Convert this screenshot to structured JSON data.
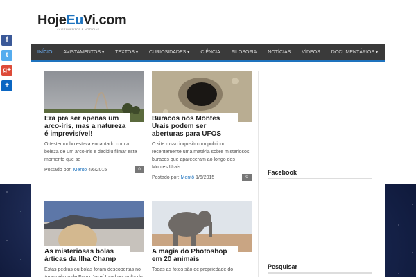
{
  "site": {
    "logo_part1": "Hoje",
    "logo_accent": "Eu",
    "logo_part2": "Vi.com",
    "tagline": "AVISTAMENTOS E NOTÍCIAS"
  },
  "nav": {
    "items": [
      {
        "label": "INÍCIO",
        "has_caret": false
      },
      {
        "label": "AVISTAMENTOS",
        "has_caret": true
      },
      {
        "label": "TEXTOS",
        "has_caret": true
      },
      {
        "label": "CURIOSIDADES",
        "has_caret": true
      },
      {
        "label": "CIÊNCIA",
        "has_caret": false
      },
      {
        "label": "FILOSOFIA",
        "has_caret": false
      },
      {
        "label": "NOTÍCIAS",
        "has_caret": false
      },
      {
        "label": "VÍDEOS",
        "has_caret": false
      },
      {
        "label": "DOCUMENTÁRIOS",
        "has_caret": true
      }
    ]
  },
  "posts": [
    {
      "title": "Era pra ser apenas um arco-íris, mas a natureza é imprevisível!",
      "excerpt": "O testemunho estava encantado com a beleza de um arco-íris e decidiu filmar este momento que se",
      "meta_prefix": "Postado por:",
      "author": "Mentö",
      "date": "4/6/2015",
      "comments": "0"
    },
    {
      "title": "Buracos nos Montes Urais podem ser aberturas para UFOS",
      "excerpt": "O site russo inquisitr.com publicou recentemente uma matéria sobre misteriosos buracos que apareceram ao longo dos Montes Urais",
      "meta_prefix": "Postado por:",
      "author": "Mentö",
      "date": "1/6/2015",
      "comments": "0"
    },
    {
      "title": "As misteriosas bolas árticas da Ilha Champ",
      "excerpt": "Estas pedras ou bolas foram descobertas no Arquipélago de Franz Josef Land por volta do"
    },
    {
      "title": "A magia do Photoshop em 20 animais",
      "excerpt": "Todas as fotos são de propriedade do"
    }
  ],
  "sidebar": {
    "widgets": [
      {
        "title": "Facebook"
      },
      {
        "title": "Pesquisar"
      }
    ]
  },
  "share": [
    {
      "icon": "facebook-icon",
      "glyph": "f",
      "color": "#3b5998"
    },
    {
      "icon": "twitter-icon",
      "glyph": "t",
      "color": "#55acee"
    },
    {
      "icon": "google-plus-icon",
      "glyph": "g+",
      "color": "#dd4b39"
    },
    {
      "icon": "share-icon",
      "glyph": "+",
      "color": "#0a66c2"
    }
  ],
  "colors": {
    "accent": "#1e73be",
    "nav_bg": "#3a3a3a"
  }
}
